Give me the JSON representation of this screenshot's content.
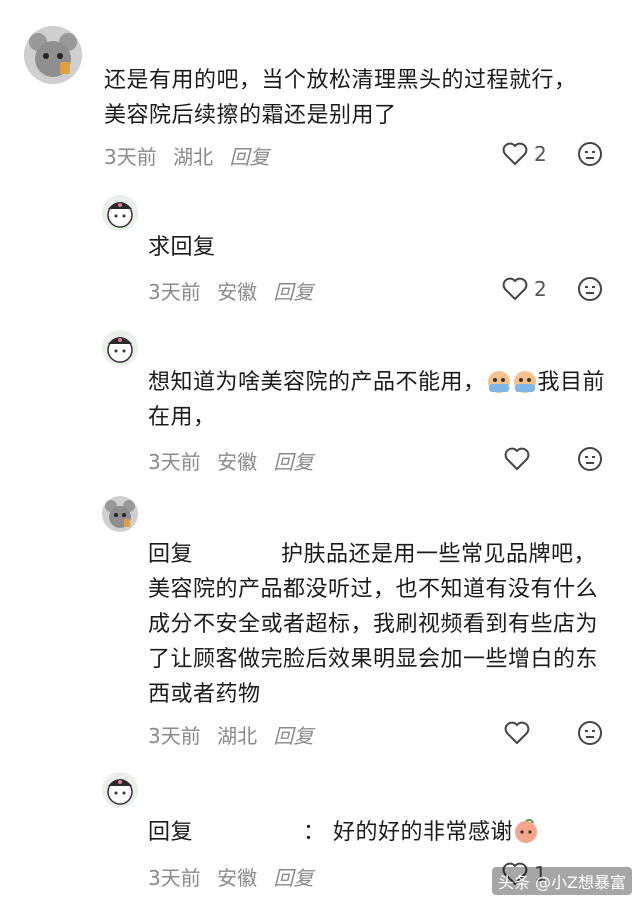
{
  "comments": [
    {
      "text": "还是有用的吧，当个放松清理黑头的过程就行，美容院后续擦的霜还是别用了",
      "time": "3天前",
      "location": "湖北",
      "reply_label": "回复",
      "likes": "2"
    },
    {
      "text": "求回复",
      "time": "3天前",
      "location": "安徽",
      "reply_label": "回复",
      "likes": "2"
    },
    {
      "text_a": "想知道为啥美容院的产品不能用，",
      "text_b": "我目前在用，",
      "time": "3天前",
      "location": "安徽",
      "reply_label": "回复",
      "likes": ""
    },
    {
      "prefix": "回复",
      "text": "护肤品还是用一些常见品牌吧，美容院的产品都没听过，也不知道有没有什么成分不安全或者超标，我刷视频看到有些店为了让顾客做完脸后效果明显会加一些增白的东西或者药物",
      "time": "3天前",
      "location": "湖北",
      "reply_label": "回复",
      "likes": ""
    },
    {
      "prefix": "回复",
      "text": "：  好的好的非常感谢",
      "time": "3天前",
      "location": "安徽",
      "reply_label": "回复",
      "likes": "1"
    }
  ],
  "watermark": "头条 @小Z想暴富",
  "colors": {
    "meta": "#8a8a8a",
    "text": "#1b1b1b"
  }
}
